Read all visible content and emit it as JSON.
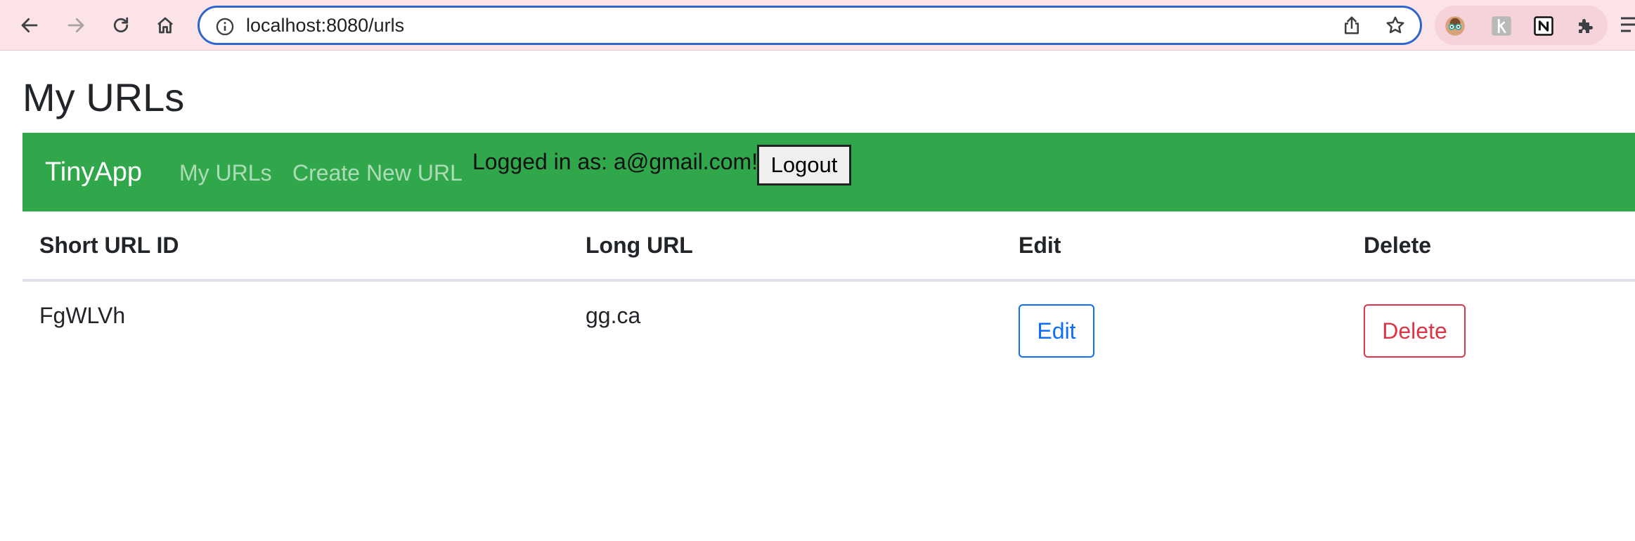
{
  "browser": {
    "url": "localhost:8080/urls",
    "icons": {
      "back": "back-arrow-icon",
      "forward": "forward-arrow-icon",
      "reload": "reload-icon",
      "home": "home-icon",
      "info": "info-icon",
      "share": "share-icon",
      "bookmark": "star-icon",
      "extensions": [
        "avatar-extension-icon",
        "k-extension-icon",
        "notion-extension-icon",
        "puzzle-extensions-icon"
      ],
      "menu": "menu-icon"
    },
    "colors": {
      "chrome_bg": "#fbe3e8",
      "omnibox_border": "#2f66c9"
    }
  },
  "page": {
    "title": "My URLs"
  },
  "navbar": {
    "brand": "TinyApp",
    "links": [
      "My URLs",
      "Create New URL"
    ],
    "logged_in_text": "Logged in as: a@gmail.com!",
    "logout_label": "Logout",
    "bg_color": "#31a74b"
  },
  "table": {
    "headers": [
      "Short URL ID",
      "Long URL",
      "Edit",
      "Delete"
    ],
    "rows": [
      {
        "short_id": "FgWLVh",
        "long_url": "gg.ca",
        "edit_label": "Edit",
        "delete_label": "Delete"
      }
    ]
  }
}
